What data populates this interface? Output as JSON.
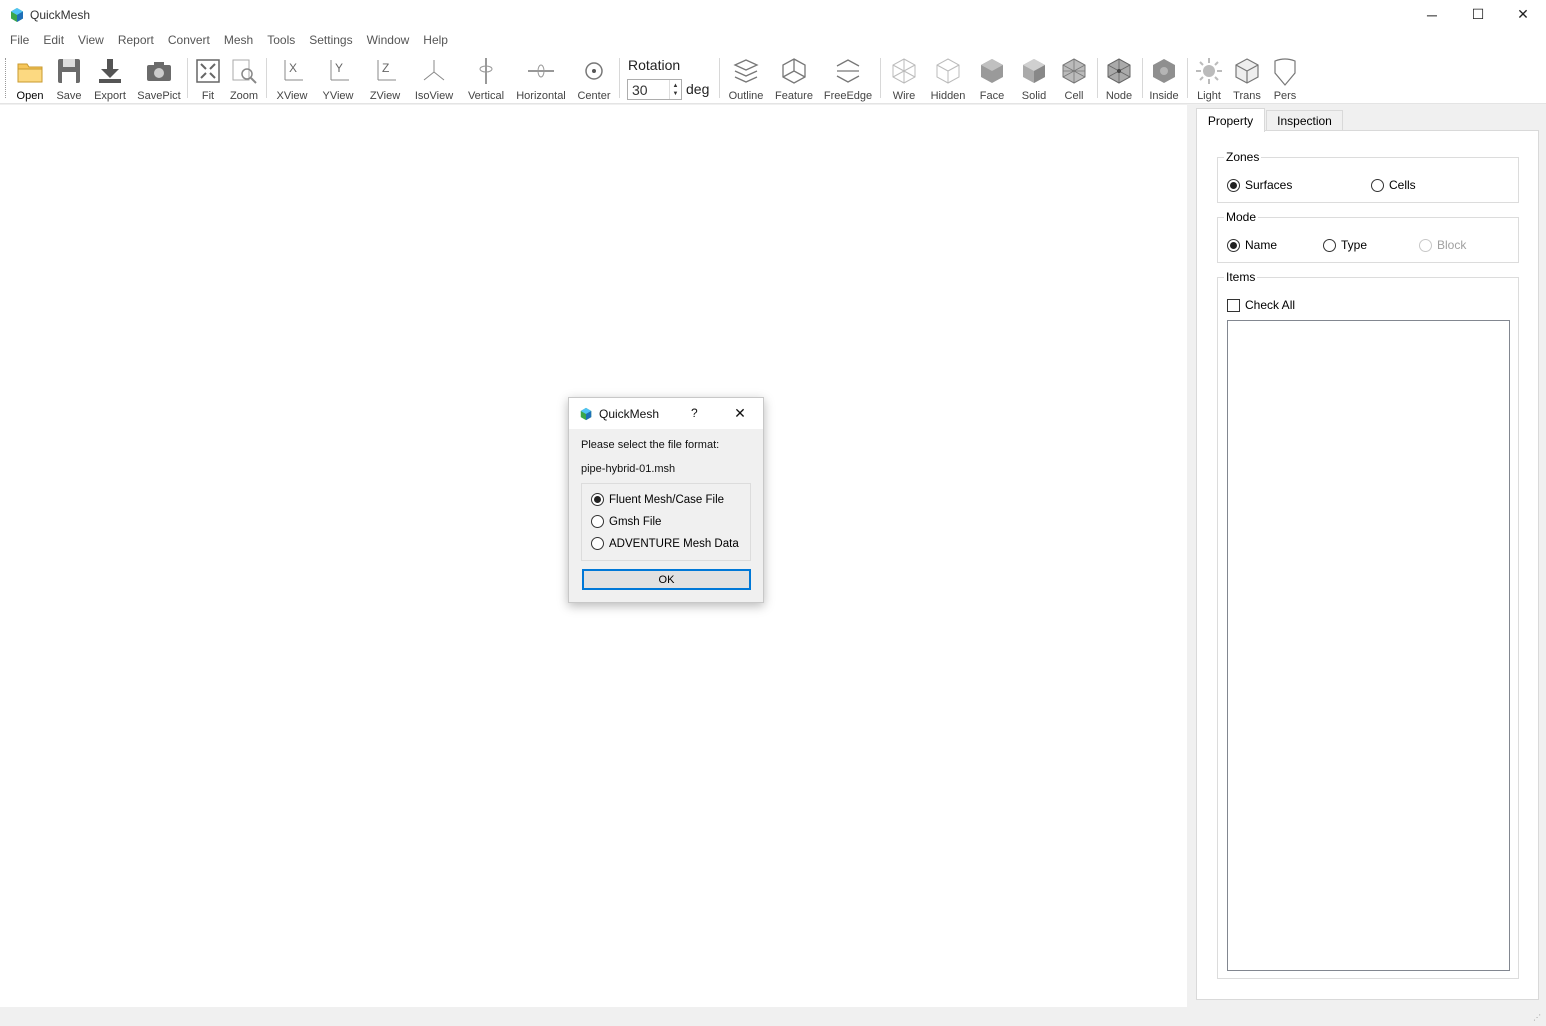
{
  "window": {
    "title": "QuickMesh",
    "minimize_glyph": "─",
    "maximize_glyph": "☐",
    "close_glyph": "✕"
  },
  "menu": [
    "File",
    "Edit",
    "View",
    "Report",
    "Convert",
    "Mesh",
    "Tools",
    "Settings",
    "Window",
    "Help"
  ],
  "toolbar": {
    "buttons": [
      {
        "label": "Open",
        "icon": "folder-icon"
      },
      {
        "label": "Save",
        "icon": "floppy-icon"
      },
      {
        "label": "Export",
        "icon": "download-icon"
      },
      {
        "label": "SavePict",
        "icon": "camera-icon"
      },
      {
        "label": "Fit",
        "icon": "fit-icon"
      },
      {
        "label": "Zoom",
        "icon": "zoom-icon"
      },
      {
        "label": "XView",
        "icon": "x-view-icon"
      },
      {
        "label": "YView",
        "icon": "y-view-icon"
      },
      {
        "label": "ZView",
        "icon": "z-view-icon"
      },
      {
        "label": "IsoView",
        "icon": "iso-view-icon"
      },
      {
        "label": "Vertical",
        "icon": "vertical-rotate-icon"
      },
      {
        "label": "Horizontal",
        "icon": "horizontal-rotate-icon"
      },
      {
        "label": "Center",
        "icon": "center-icon"
      },
      {
        "label": "Outline",
        "icon": "outline-icon"
      },
      {
        "label": "Feature",
        "icon": "feature-icon"
      },
      {
        "label": "FreeEdge",
        "icon": "free-edge-icon"
      },
      {
        "label": "Wire",
        "icon": "wire-icon"
      },
      {
        "label": "Hidden",
        "icon": "hidden-icon"
      },
      {
        "label": "Face",
        "icon": "face-icon"
      },
      {
        "label": "Solid",
        "icon": "solid-icon"
      },
      {
        "label": "Cell",
        "icon": "cell-icon"
      },
      {
        "label": "Node",
        "icon": "node-icon"
      },
      {
        "label": "Inside",
        "icon": "inside-icon"
      },
      {
        "label": "Light",
        "icon": "light-icon"
      },
      {
        "label": "Trans",
        "icon": "trans-icon"
      },
      {
        "label": "Pers",
        "icon": "pers-icon"
      }
    ],
    "rotation": {
      "label": "Rotation",
      "value": "30",
      "unit": "deg"
    }
  },
  "panel": {
    "tabs": [
      "Property",
      "Inspection"
    ],
    "zones": {
      "title": "Zones",
      "options": [
        "Surfaces",
        "Cells"
      ],
      "selected": "Surfaces"
    },
    "mode": {
      "title": "Mode",
      "options": [
        "Name",
        "Type",
        "Block"
      ],
      "selected": "Name",
      "disabled": [
        "Block"
      ]
    },
    "items": {
      "title": "Items",
      "check_all": "Check All"
    }
  },
  "dialog": {
    "title": "QuickMesh",
    "help": "?",
    "close_glyph": "✕",
    "message": "Please select the file format:",
    "filename": "pipe-hybrid-01.msh",
    "options": [
      "Fluent Mesh/Case File",
      "Gmsh File",
      "ADVENTURE Mesh Data"
    ],
    "selected": "Fluent Mesh/Case File",
    "ok_label": "OK"
  },
  "colors": {
    "accent": "#0078d7",
    "icon_gray": "#6b6b6b",
    "icon_light": "#bdbdbd"
  }
}
